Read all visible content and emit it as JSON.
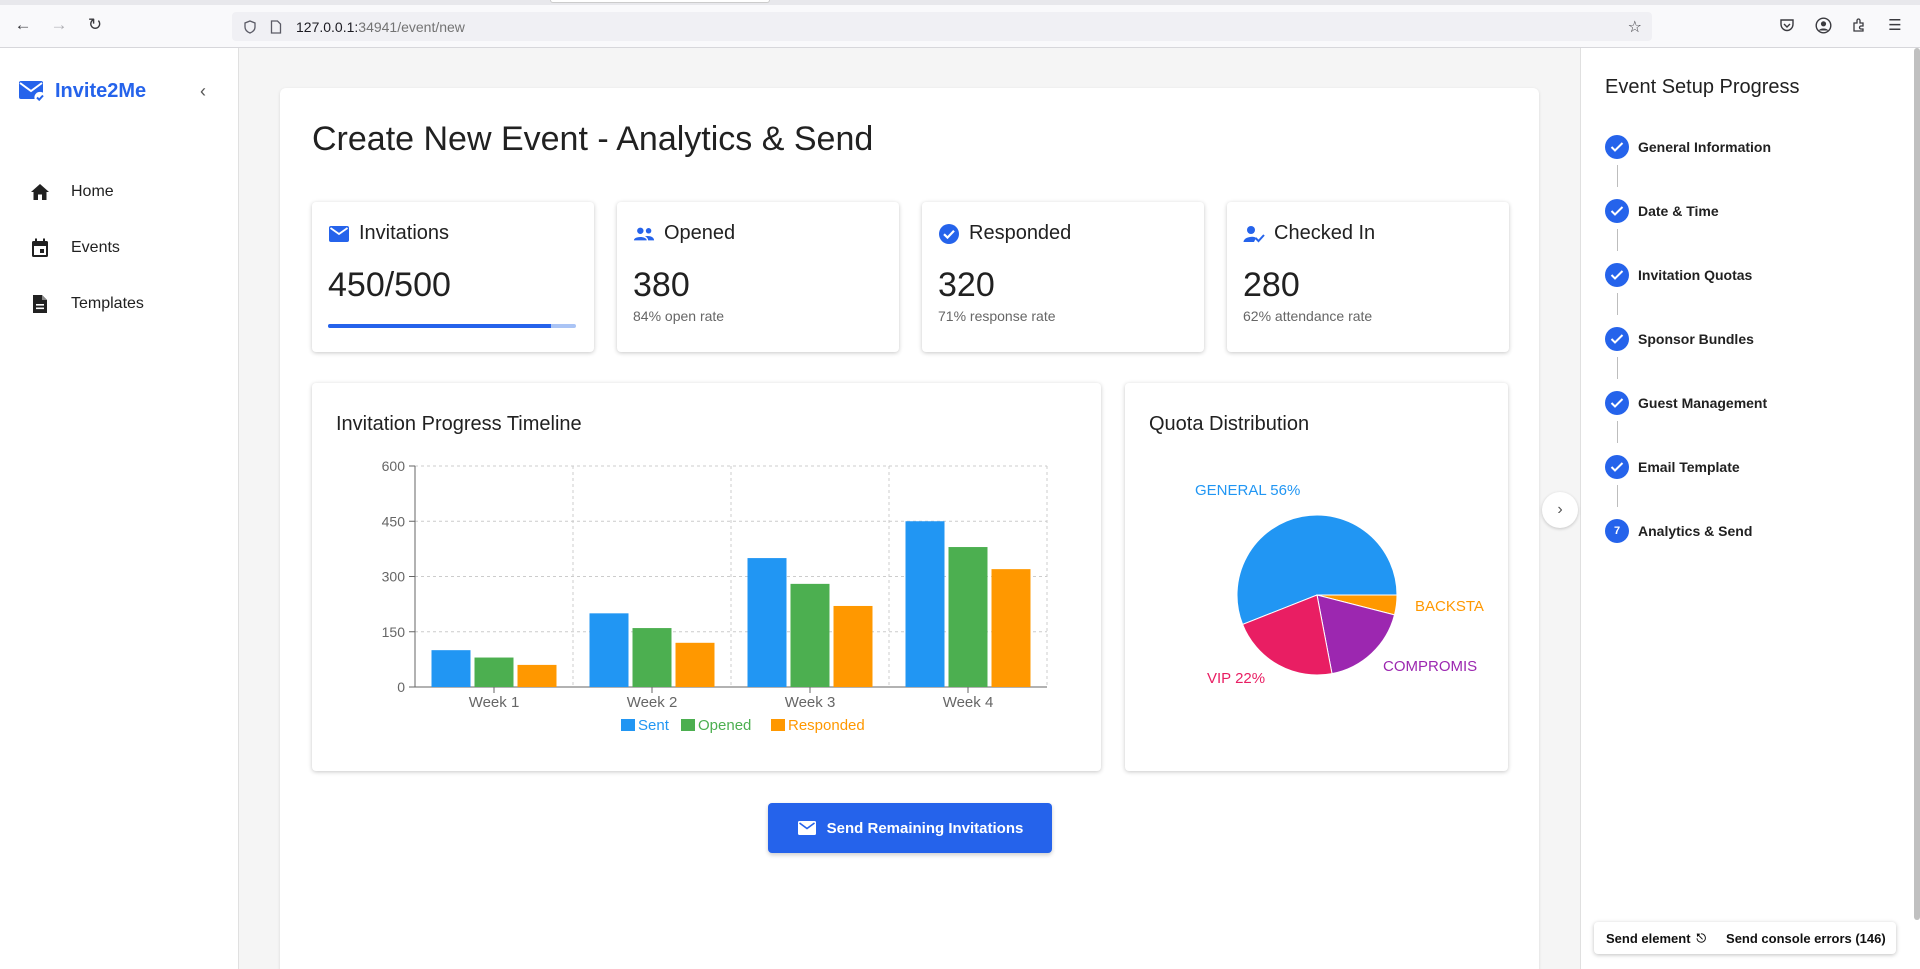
{
  "browser": {
    "url_host": "127.0.0.1:",
    "url_path": "34941/event/new",
    "icons": [
      "back-icon",
      "forward-icon",
      "reload-icon",
      "shield-icon",
      "page-icon",
      "star-icon",
      "pocket-icon",
      "account-icon",
      "extensions-icon",
      "menu-icon"
    ]
  },
  "sidebar": {
    "brand": "Invite2Me",
    "items": [
      {
        "label": "Home",
        "icon": "home-icon"
      },
      {
        "label": "Events",
        "icon": "calendar-icon"
      },
      {
        "label": "Templates",
        "icon": "document-icon"
      }
    ]
  },
  "main": {
    "title": "Create New Event - Analytics & Send",
    "stats": [
      {
        "title": "Invitations",
        "value": "450/500",
        "sub": "",
        "icon": "mail-icon",
        "progress": 0.9
      },
      {
        "title": "Opened",
        "value": "380",
        "sub": "84% open rate",
        "icon": "people-icon"
      },
      {
        "title": "Responded",
        "value": "320",
        "sub": "71% response rate",
        "icon": "check-circle-icon"
      },
      {
        "title": "Checked In",
        "value": "280",
        "sub": "62% attendance rate",
        "icon": "person-check-icon"
      }
    ],
    "send_button": "Send Remaining Invitations"
  },
  "chart_data": [
    {
      "type": "bar",
      "title": "Invitation Progress Timeline",
      "categories": [
        "Week 1",
        "Week 2",
        "Week 3",
        "Week 4"
      ],
      "series": [
        {
          "name": "Sent",
          "values": [
            100,
            200,
            350,
            450
          ],
          "color": "#2196F3"
        },
        {
          "name": "Opened",
          "values": [
            80,
            160,
            280,
            380
          ],
          "color": "#4CAF50"
        },
        {
          "name": "Responded",
          "values": [
            60,
            120,
            220,
            320
          ],
          "color": "#FF9800"
        }
      ],
      "ylim": [
        0,
        600
      ],
      "yticks": [
        "0",
        "150",
        "300",
        "450",
        "600"
      ],
      "grid": true,
      "legend": "bottom"
    },
    {
      "type": "pie",
      "title": "Quota Distribution",
      "slices": [
        {
          "label": "GENERAL 56%",
          "value": 56,
          "color": "#2196F3"
        },
        {
          "label": "BACKSTA",
          "value": 4,
          "color": "#FF9800"
        },
        {
          "label": "COMPROMIS",
          "value": 18,
          "color": "#9C27B0"
        },
        {
          "label": "VIP 22%",
          "value": 22,
          "color": "#E91E63"
        }
      ]
    }
  ],
  "right_panel": {
    "title": "Event Setup Progress",
    "steps": [
      {
        "label": "General Information",
        "done": true
      },
      {
        "label": "Date & Time",
        "done": true
      },
      {
        "label": "Invitation Quotas",
        "done": true
      },
      {
        "label": "Sponsor Bundles",
        "done": true
      },
      {
        "label": "Guest Management",
        "done": true
      },
      {
        "label": "Email Template",
        "done": true
      },
      {
        "label": "Analytics & Send",
        "done": false,
        "number": "7"
      }
    ]
  },
  "devtools": {
    "send_element": "Send element",
    "send_errors": "Send console errors (146)"
  },
  "colors": {
    "accent": "#2563eb"
  }
}
